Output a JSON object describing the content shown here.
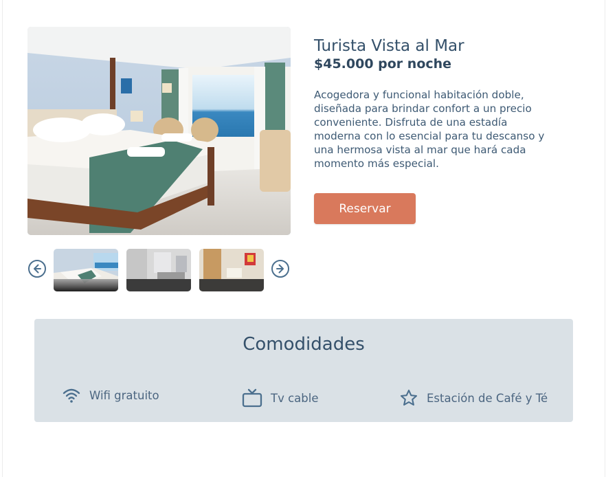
{
  "room": {
    "title": "Turista Vista al Mar",
    "price": "$45.000 por noche",
    "description": "Acogedora y funcional habitación doble, diseñada para brindar confort a un precio conveniente. Disfruta de una estadía moderna con lo esencial para tu descanso y una hermosa vista al mar que hará cada momento más especial.",
    "book_label": "Reservar"
  },
  "gallery": {
    "main_image": "hotel-room-photo",
    "thumbnails": [
      "bedroom-thumbnail",
      "bathroom-thumbnail",
      "room-detail-thumbnail"
    ],
    "prev_icon": "arrow-left-circle-icon",
    "next_icon": "arrow-right-circle-icon"
  },
  "amenities": {
    "title": "Comodidades",
    "items": [
      {
        "icon": "wifi-icon",
        "label": "Wifi gratuito"
      },
      {
        "icon": "tv-icon",
        "label": "Tv cable"
      },
      {
        "icon": "star-icon",
        "label": "Estación de Café y Té"
      }
    ]
  },
  "colors": {
    "heading": "#34506a",
    "accent_button": "#d9795c",
    "amenities_bg": "#dae1e6"
  }
}
